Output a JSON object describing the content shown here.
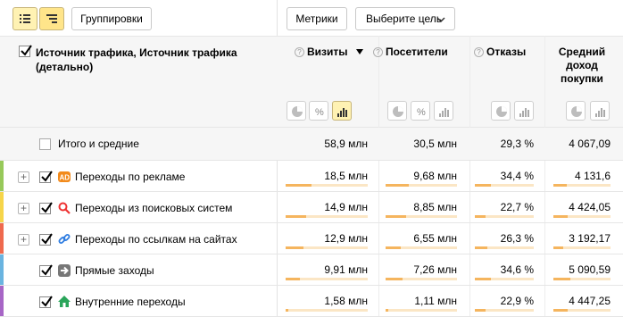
{
  "toolbar": {
    "list_view_icon": "list-icon",
    "tree_view_icon": "tree-icon",
    "groupings_label": "Группировки",
    "metrics_label": "Метрики",
    "goal_select_label": "Выберите цель"
  },
  "header": {
    "dimension_label": "Источник трафика, Источник трафика (детально)",
    "columns": [
      {
        "label": "Визиты",
        "sorted": "desc",
        "help": "?"
      },
      {
        "label": "Посетители",
        "help": "?"
      },
      {
        "label": "Отказы",
        "help": "?"
      },
      {
        "label": "Средний доход покупки"
      }
    ]
  },
  "totals": {
    "label": "Итого и средние",
    "visits": "58,9 млн",
    "visitors": "30,5 млн",
    "bounce": "29,3 %",
    "revenue": "4 067,09"
  },
  "rows": [
    {
      "label": "Переходы по рекламе",
      "icon": "ad-icon",
      "stripe": "#97c95a",
      "visits": "18,5 млн",
      "visitors": "9,68 млн",
      "bounce": "34,4 %",
      "revenue": "4 131,6",
      "bars": [
        0.31,
        0.32,
        0.27,
        0.23
      ]
    },
    {
      "label": "Переходы из поисковых систем",
      "icon": "search-icon",
      "stripe": "#f6d54a",
      "visits": "14,9 млн",
      "visitors": "8,85 млн",
      "bounce": "22,7 %",
      "revenue": "4 424,05",
      "bars": [
        0.25,
        0.29,
        0.18,
        0.25
      ]
    },
    {
      "label": "Переходы по ссылкам на сайтах",
      "icon": "link-icon",
      "stripe": "#ef6a4e",
      "visits": "12,9 млн",
      "visitors": "6,55 млн",
      "bounce": "26,3 %",
      "revenue": "3 192,17",
      "bars": [
        0.22,
        0.21,
        0.21,
        0.17
      ]
    },
    {
      "label": "Прямые заходы",
      "icon": "arrow-right-icon",
      "stripe": "#6ab4e0",
      "visits": "9,91 млн",
      "visitors": "7,26 млн",
      "bounce": "34,6 %",
      "revenue": "5 090,59",
      "bars": [
        0.17,
        0.24,
        0.27,
        0.29
      ]
    },
    {
      "label": "Внутренние переходы",
      "icon": "home-icon",
      "stripe": "#a766c6",
      "visits": "1,58 млн",
      "visitors": "1,11 млн",
      "bounce": "22,9 %",
      "revenue": "4 447,25",
      "bars": [
        0.03,
        0.04,
        0.18,
        0.25
      ]
    }
  ]
}
